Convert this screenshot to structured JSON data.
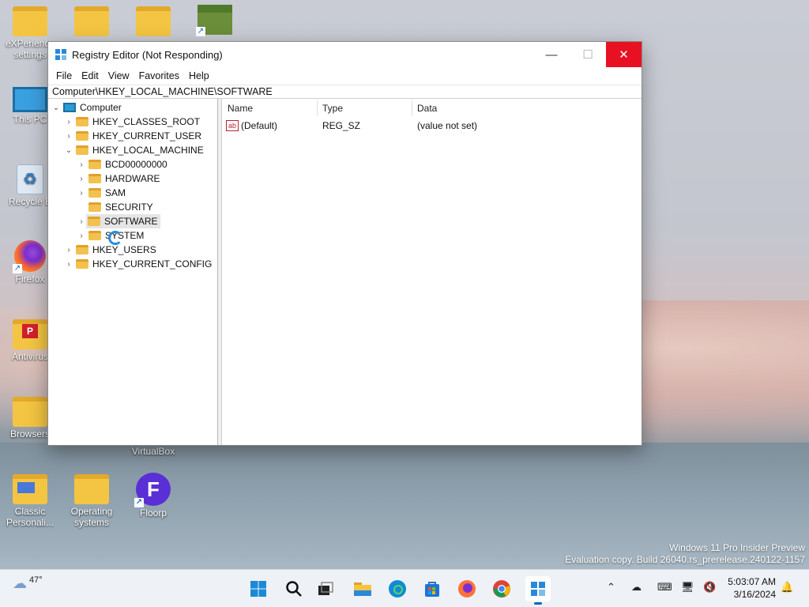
{
  "desktop": {
    "icons": [
      {
        "label": "eXPerience settings",
        "line1": "eXPerience",
        "line2": "settings"
      },
      {
        "label": "This PC"
      },
      {
        "label": "Recycle Bin",
        "display": "Recycle B"
      },
      {
        "label": "Firefox"
      },
      {
        "label": "Antivirus",
        "display": "Antivirus"
      },
      {
        "label": "Browsers"
      },
      {
        "label": "VirtualBox"
      },
      {
        "label": "Classic Personali...",
        "line1": "Classic",
        "line2": "Personali..."
      },
      {
        "label": "Operating systems",
        "line1": "Operating",
        "line2": "systems"
      },
      {
        "label": "Floorp"
      }
    ]
  },
  "window": {
    "title": "Registry Editor (Not Responding)",
    "menu": [
      "File",
      "Edit",
      "View",
      "Favorites",
      "Help"
    ],
    "address": "Computer\\HKEY_LOCAL_MACHINE\\SOFTWARE",
    "controls": {
      "minimize": "—",
      "maximize": "☐",
      "close": "✕"
    }
  },
  "tree": {
    "root": "Computer",
    "hives": [
      "HKEY_CLASSES_ROOT",
      "HKEY_CURRENT_USER",
      "HKEY_LOCAL_MACHINE",
      "HKEY_USERS",
      "HKEY_CURRENT_CONFIG"
    ],
    "hklm_children": [
      "BCD00000000",
      "HARDWARE",
      "SAM",
      "SECURITY",
      "SOFTWARE",
      "SYSTEM"
    ],
    "selected": "SOFTWARE"
  },
  "list": {
    "columns": [
      "Name",
      "Type",
      "Data"
    ],
    "rows": [
      {
        "name": "(Default)",
        "type": "REG_SZ",
        "data": "(value not set)"
      }
    ]
  },
  "watermark": {
    "line1": "Windows 11 Pro Insider Preview",
    "line2": "Evaluation copy. Build 26040.rs_prerelease.240122-1157"
  },
  "taskbar": {
    "weather": "47°",
    "time": "5:03:07 AM",
    "date": "3/16/2024"
  },
  "colors": {
    "accent": "#0067c0",
    "close": "#e81123"
  }
}
